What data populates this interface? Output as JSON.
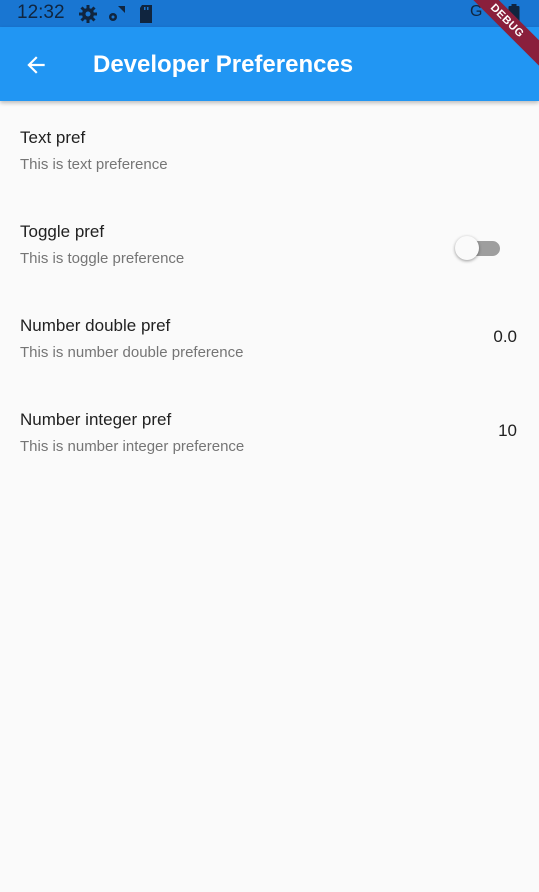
{
  "status_bar": {
    "time": "12:32",
    "icons": [
      "gear-icon",
      "signal-icon",
      "sd-card-icon"
    ],
    "network": "G"
  },
  "app_bar": {
    "title": "Developer Preferences",
    "back_icon": "arrow-back-icon"
  },
  "debug_banner": "DEBUG",
  "colors": {
    "app_bar": "#2196f3",
    "status_bar": "#1976d2",
    "background": "#fafafa"
  },
  "preferences": [
    {
      "title": "Text pref",
      "subtitle": "This is text preference"
    },
    {
      "title": "Toggle pref",
      "subtitle": "This is toggle preference",
      "toggle_on": false
    },
    {
      "title": "Number double pref",
      "subtitle": "This is number double preference",
      "value": "0.0"
    },
    {
      "title": "Number integer pref",
      "subtitle": "This is number integer preference",
      "value": "10"
    }
  ]
}
